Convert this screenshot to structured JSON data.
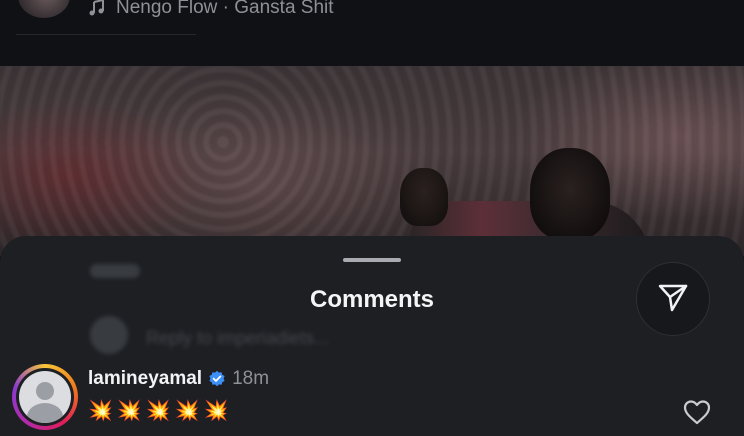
{
  "post_header": {
    "music_text": "Nengo Flow · Gansta Shit"
  },
  "comments_sheet": {
    "title": "Comments",
    "background_reply_text": "Reply to imperiadiets..."
  },
  "comments": [
    {
      "username": "lamineyamal",
      "verified": true,
      "time": "18m",
      "text": "💥💥💥💥💥"
    }
  ],
  "colors": {
    "sheet_background": "#1d1f23",
    "verified_badge": "#3d8ef5",
    "emoji_accent": "#ff7a1a"
  },
  "icons": [
    "music-note-icon",
    "share-icon",
    "verified-badge-icon",
    "heart-icon"
  ]
}
